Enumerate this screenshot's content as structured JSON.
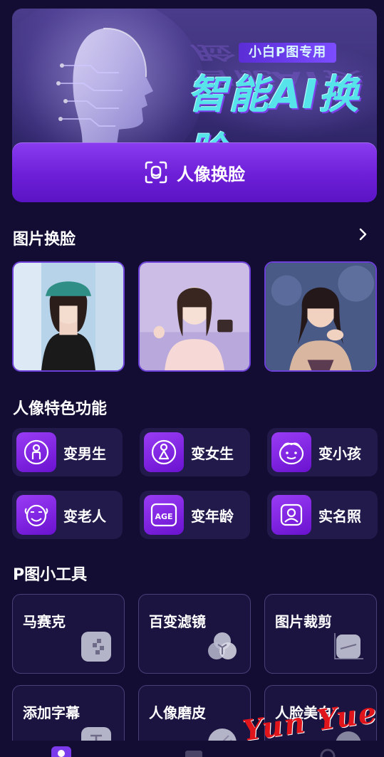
{
  "banner": {
    "tag": "小白P图专用",
    "title": "智能AI换脸",
    "cta_label": "人像换脸"
  },
  "photo_swap": {
    "title": "图片换脸"
  },
  "features": {
    "title": "人像特色功能",
    "items": [
      {
        "label": "变男生",
        "icon": "male-icon"
      },
      {
        "label": "变女生",
        "icon": "female-icon"
      },
      {
        "label": "变小孩",
        "icon": "child-icon"
      },
      {
        "label": "变老人",
        "icon": "elder-icon"
      },
      {
        "label": "变年龄",
        "icon": "age-icon"
      },
      {
        "label": "实名照",
        "icon": "id-photo-icon"
      }
    ],
    "age_icon_text": "AGE"
  },
  "tools": {
    "title": "P图小工具",
    "items": [
      {
        "label": "马赛克",
        "icon": "mosaic-icon"
      },
      {
        "label": "百变滤镜",
        "icon": "filter-icon"
      },
      {
        "label": "图片裁剪",
        "icon": "crop-icon"
      },
      {
        "label": "添加字幕",
        "icon": "text-icon"
      },
      {
        "label": "人像磨皮",
        "icon": "smooth-icon"
      },
      {
        "label": "人脸美白",
        "icon": "whiten-icon"
      }
    ]
  },
  "watermark": "Yun Yue",
  "colors": {
    "background": "#130d33",
    "accent": "#7c3aed",
    "cyan_title": "#56e3ea"
  }
}
